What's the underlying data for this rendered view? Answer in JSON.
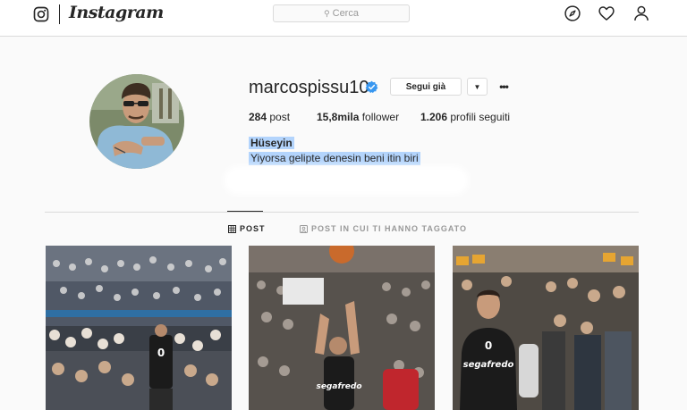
{
  "header": {
    "brand": "Instagram",
    "search_placeholder": "Cerca",
    "icons": [
      "instagram-glyph-icon",
      "compass-icon",
      "heart-icon",
      "person-icon"
    ]
  },
  "profile": {
    "username": "marcospissu10",
    "verified": true,
    "follow_label": "Segui già",
    "dropdown_glyph": "▼",
    "more_glyph": "•••",
    "stats": {
      "posts_value": "284",
      "posts_label": "post",
      "followers_value": "15,8mila",
      "followers_label": "follower",
      "following_value": "1.206",
      "following_label": "profili seguiti"
    },
    "bio_name": "Hüseyin",
    "bio_text": "Yiyorsa gelipte denesin beni itin biri"
  },
  "tabs": [
    {
      "label": "POST",
      "active": true,
      "icon": "grid-icon"
    },
    {
      "label": "POST IN CUI TI HANNO TAGGATO",
      "active": false,
      "icon": "tag-person-icon"
    }
  ],
  "posts": [
    {
      "jersey_number": "0",
      "kind": "arena-crowd-photo"
    },
    {
      "kind": "free-throw-photo"
    },
    {
      "jersey_number": "0",
      "kind": "player-portrait-photo"
    }
  ],
  "colors": {
    "accent_blue": "#3897f0",
    "selection": "#b3d4fc",
    "border": "#dbdbdb",
    "text": "#262626",
    "muted": "#999999",
    "background": "#fafafa"
  }
}
